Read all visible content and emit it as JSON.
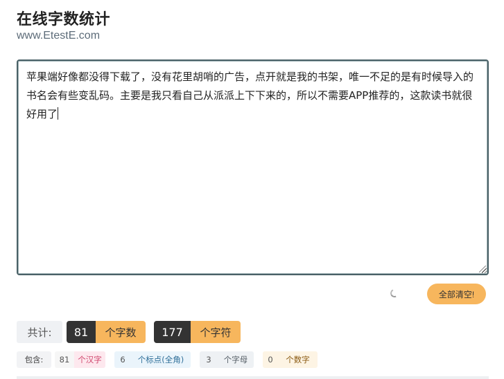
{
  "header": {
    "title": "在线字数统计",
    "site": "www.EtestE.com"
  },
  "editor": {
    "text": "苹果端好像都没得下载了，没有花里胡哨的广告，点开就是我的书架，唯一不足的是有时候导入的书名会有些变乱码。主要是我只看自己从派派上下下来的，所以不需要APP推荐的，这款读书就很好用了"
  },
  "actions": {
    "clear_label": "全部清空!"
  },
  "totals": {
    "label": "共计:",
    "word_count": "81",
    "word_unit": "个字数",
    "char_count": "177",
    "char_unit": "个字符"
  },
  "details": {
    "label": "包含:",
    "hanzi_count": "81",
    "hanzi_unit": "个汉字",
    "punct_count": "6",
    "punct_unit": "个标点(全角)",
    "alpha_count": "3",
    "alpha_unit": "个字母",
    "digit_count": "0",
    "digit_unit": "个数字"
  },
  "colors": {
    "accent": "#f7b65d",
    "dark": "#333333",
    "border": "#4a6167"
  }
}
